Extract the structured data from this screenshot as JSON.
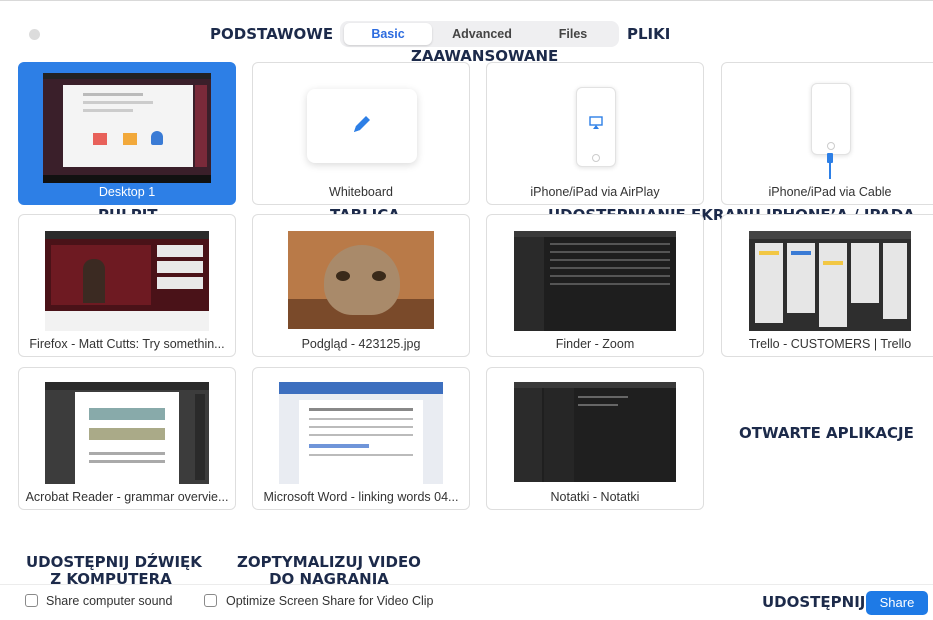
{
  "tabs": [
    {
      "label": "Basic",
      "active": true
    },
    {
      "label": "Advanced",
      "active": false
    },
    {
      "label": "Files",
      "active": false
    }
  ],
  "annotations": {
    "podstawowe": "PODSTAWOWE",
    "zaawansowane": "ZAAWANSOWANE",
    "pliki": "PLIKI",
    "pulpit": "PULPIT",
    "tablica": "TABLICA",
    "iphone": "UDOSTĘPNIANIE EKRANU IPHONE’A / IPADA",
    "apps": "OTWARTE APLIKACJE",
    "sound1": "UDOSTĘPNIJ DŹWIĘK",
    "sound2": "Z KOMPUTERA",
    "video1": "ZOPTYMALIZUJ VIDEO",
    "video2": "DO NAGRANIA",
    "udostepnij": "UDOSTĘPNIJ"
  },
  "tiles": [
    {
      "label": "Desktop 1",
      "selected": true
    },
    {
      "label": "Whiteboard"
    },
    {
      "label": "iPhone/iPad via AirPlay"
    },
    {
      "label": "iPhone/iPad via Cable"
    },
    {
      "label": "Firefox - Matt Cutts: Try somethin..."
    },
    {
      "label": "Podgląd - 423125.jpg"
    },
    {
      "label": "Finder - Zoom"
    },
    {
      "label": "Trello - CUSTOMERS | Trello"
    },
    {
      "label": "Acrobat Reader - grammar overvie..."
    },
    {
      "label": "Microsoft Word - linking words 04..."
    },
    {
      "label": "Notatki - Notatki"
    }
  ],
  "footer": {
    "share_sound": "Share computer sound",
    "optimize": "Optimize Screen Share for Video Clip",
    "share_button": "Share"
  },
  "colors": {
    "accent": "#1e7ae6",
    "annotation": "#1c2a4a"
  }
}
